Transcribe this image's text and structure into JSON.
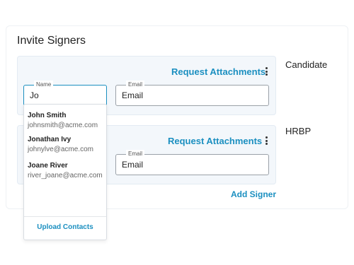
{
  "title": "Invite Signers",
  "signers": [
    {
      "role": "Candidate",
      "request_label": "Request Attachments",
      "name_label": "Name",
      "name_value": "Jo",
      "email_label": "Email",
      "email_value": "Email"
    },
    {
      "role": "HRBP",
      "request_label": "Request Attachments",
      "email_label": "Email",
      "email_value": "Email"
    }
  ],
  "add_signer_label": "Add Signer",
  "suggestions": {
    "items": [
      {
        "name": "John Smith",
        "email": "johnsmith@acme.com"
      },
      {
        "name": "Jonathan Ivy",
        "email": "johnylve@acme.com"
      },
      {
        "name": "Joane River",
        "email": "river_joane@acme.com"
      }
    ],
    "upload_label": "Upload Contacts"
  },
  "colors": {
    "accent": "#1b8fc0",
    "card_bg": "#f3f7fb",
    "text": "#222222"
  },
  "icons": {
    "menu": "kebab-vertical-icon"
  }
}
